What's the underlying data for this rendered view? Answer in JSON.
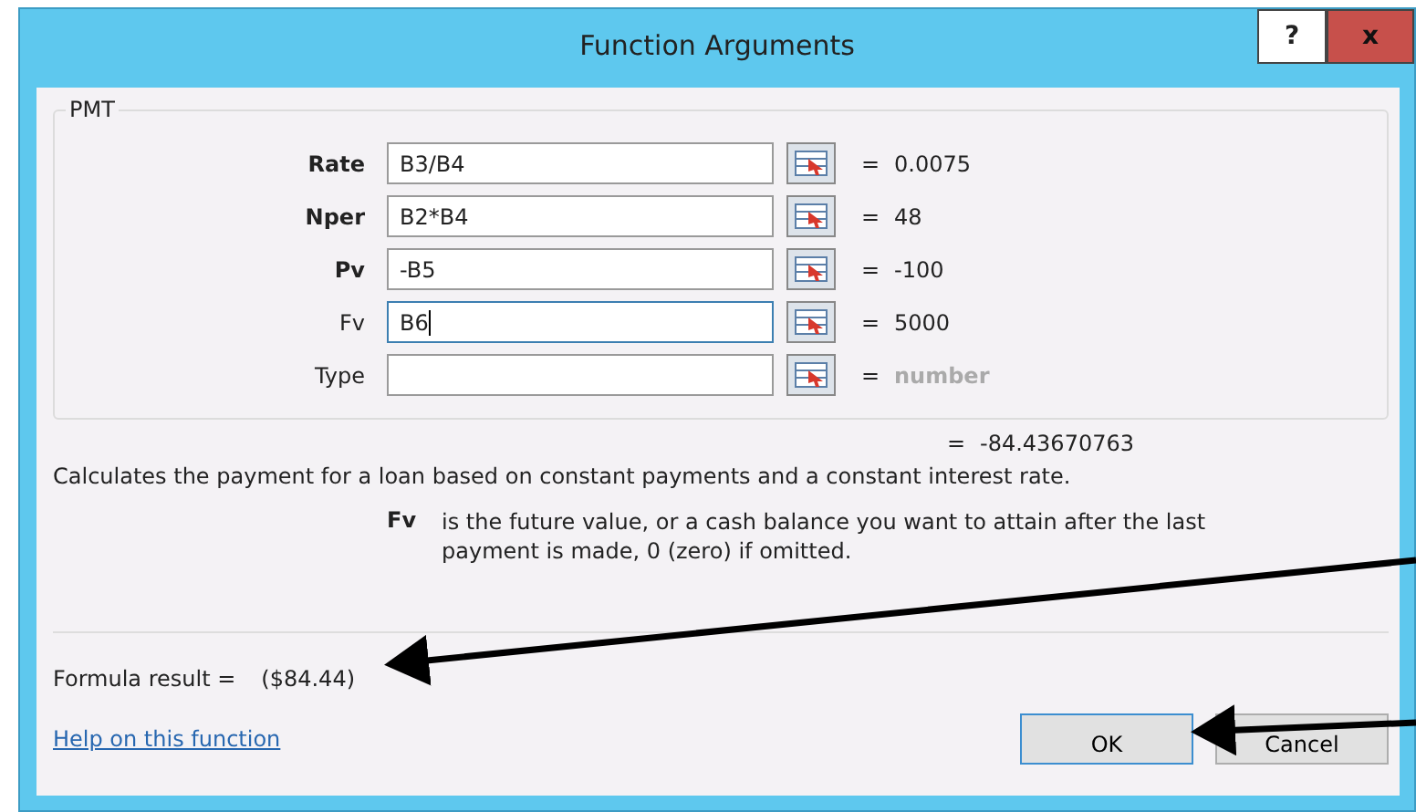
{
  "window": {
    "title": "Function Arguments",
    "help_button": "?",
    "close_button": "x"
  },
  "group": {
    "title": "PMT",
    "arguments": [
      {
        "label": "Rate",
        "required": true,
        "value": "B3/B4",
        "focused": false,
        "result": "0.0075",
        "result_is_hint": false
      },
      {
        "label": "Nper",
        "required": true,
        "value": "B2*B4",
        "focused": false,
        "result": "48",
        "result_is_hint": false
      },
      {
        "label": "Pv",
        "required": true,
        "value": "-B5",
        "focused": false,
        "result": "-100",
        "result_is_hint": false
      },
      {
        "label": "Fv",
        "required": false,
        "value": "B6",
        "focused": true,
        "result": "5000",
        "result_is_hint": false
      },
      {
        "label": "Type",
        "required": false,
        "focused": false,
        "result": "number",
        "result_is_hint": true
      }
    ]
  },
  "equals": "=",
  "function_result": "-84.43670763",
  "description": "Calculates the payment for a loan based on constant payments and a constant interest rate.",
  "argument_help": {
    "name": "Fv",
    "text": "is the future value, or a cash balance you want to attain after the last payment is made, 0 (zero) if omitted."
  },
  "formula_result": {
    "label": "Formula result =",
    "value": "($84.44)"
  },
  "help_link": "Help on this function",
  "buttons": [
    "OK",
    "Cancel"
  ]
}
